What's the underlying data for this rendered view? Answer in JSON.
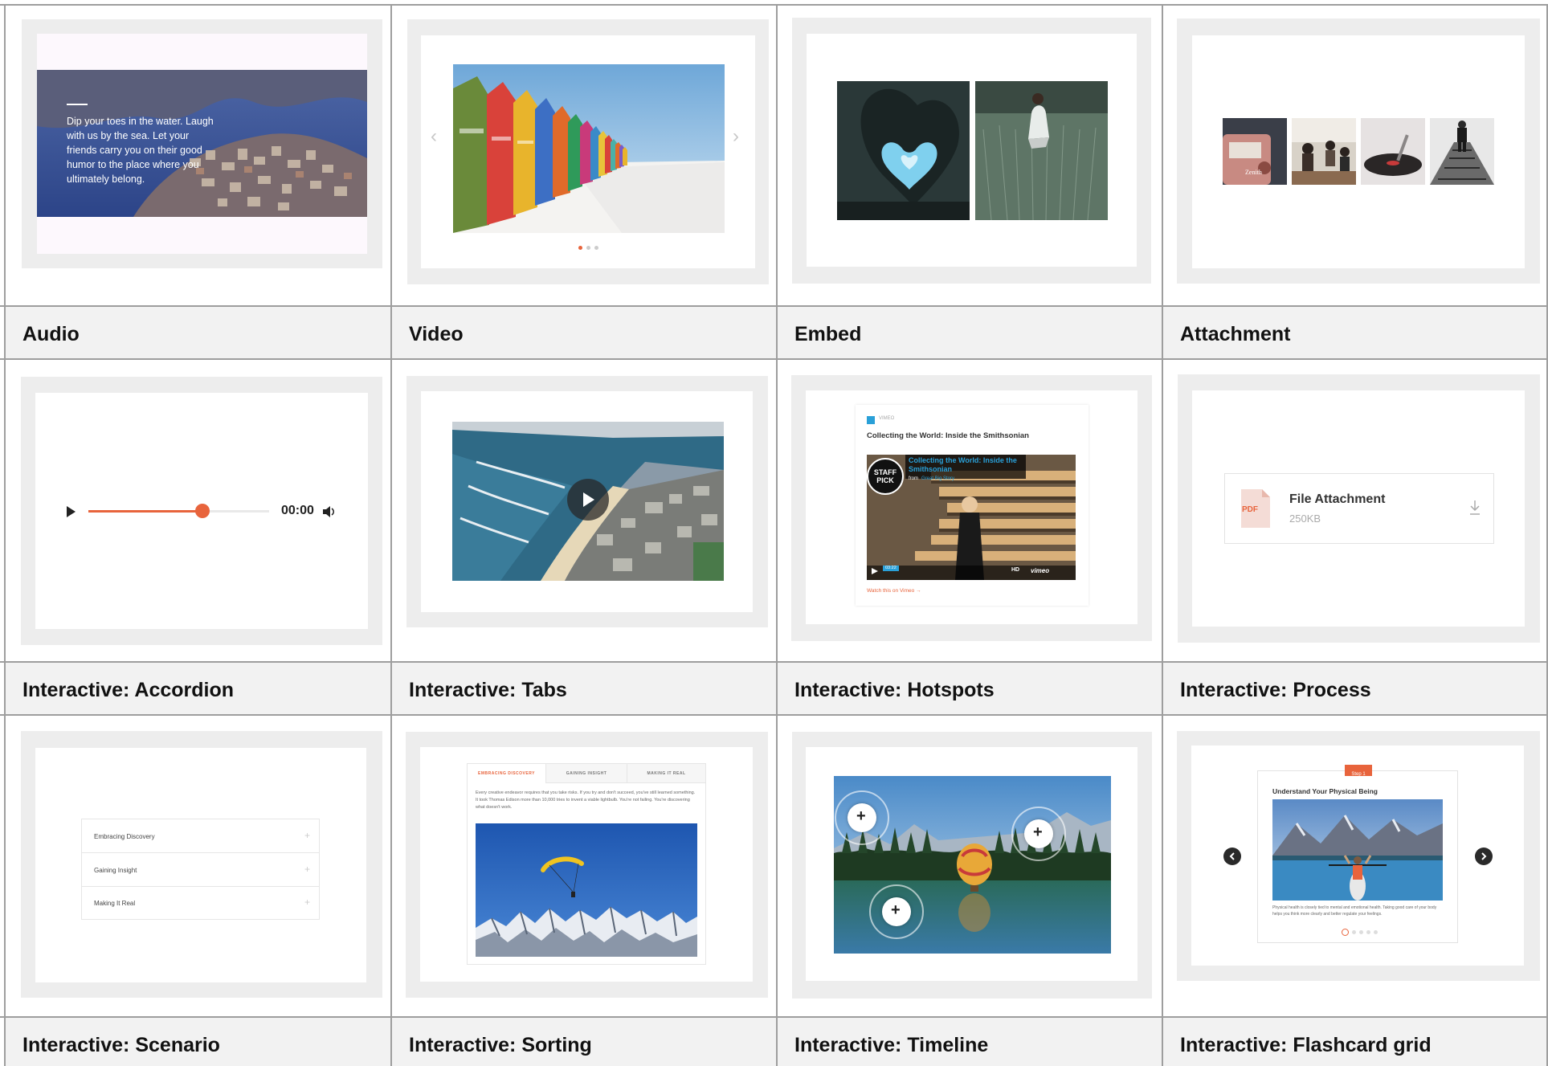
{
  "labels": [
    "Audio",
    "Video",
    "Embed",
    "Attachment",
    "Interactive: Accordion",
    "Interactive: Tabs",
    "Interactive: Hotspots",
    "Interactive: Process",
    "Interactive: Scenario",
    "Interactive: Sorting",
    "Interactive: Timeline",
    "Interactive: Flashcard grid"
  ],
  "audio_caption": "Dip your toes in the water. Laugh with us by the sea. Let your friends carry you on their good humor to the place where you ultimately belong.",
  "audio_player": {
    "time": "00:00",
    "progress": 0.63
  },
  "embed": {
    "brand": "VIMEO",
    "title": "Collecting the World: Inside the Smithsonian",
    "video_title": "Collecting the World: Inside the Smithsonian",
    "from_prefix": "from",
    "from_channel": "Great Big Story",
    "badge": "STAFF PICK",
    "duration": "03:22",
    "hd": "HD",
    "vimeo": "vimeo",
    "link": "Watch this on Vimeo →"
  },
  "file": {
    "badge": "PDF",
    "name": "File Attachment",
    "size": "250KB"
  },
  "accordion": [
    "Embracing Discovery",
    "Gaining Insight",
    "Making It Real"
  ],
  "tabs": {
    "items": [
      "EMBRACING DISCOVERY",
      "GAINING INSIGHT",
      "MAKING IT REAL"
    ],
    "text": "Every creative endeavor requires that you take risks. If you try and don't succeed, you've still learned something. It took Thomas Edison more than 10,000 tries to invent a viable lightbulb. You're not failing. You're discovering what doesn't work."
  },
  "flashcard": {
    "step": "Step 1",
    "title": "Understand Your Physical Being",
    "text": "Physical health is closely tied to mental and emotional health. Taking good care of your body helps you think more clearly and better regulate your feelings."
  },
  "colors": {
    "accent": "#e8643c",
    "border": "#9e9e9e",
    "frame": "#ededed",
    "label_bg": "#f2f2f2"
  }
}
